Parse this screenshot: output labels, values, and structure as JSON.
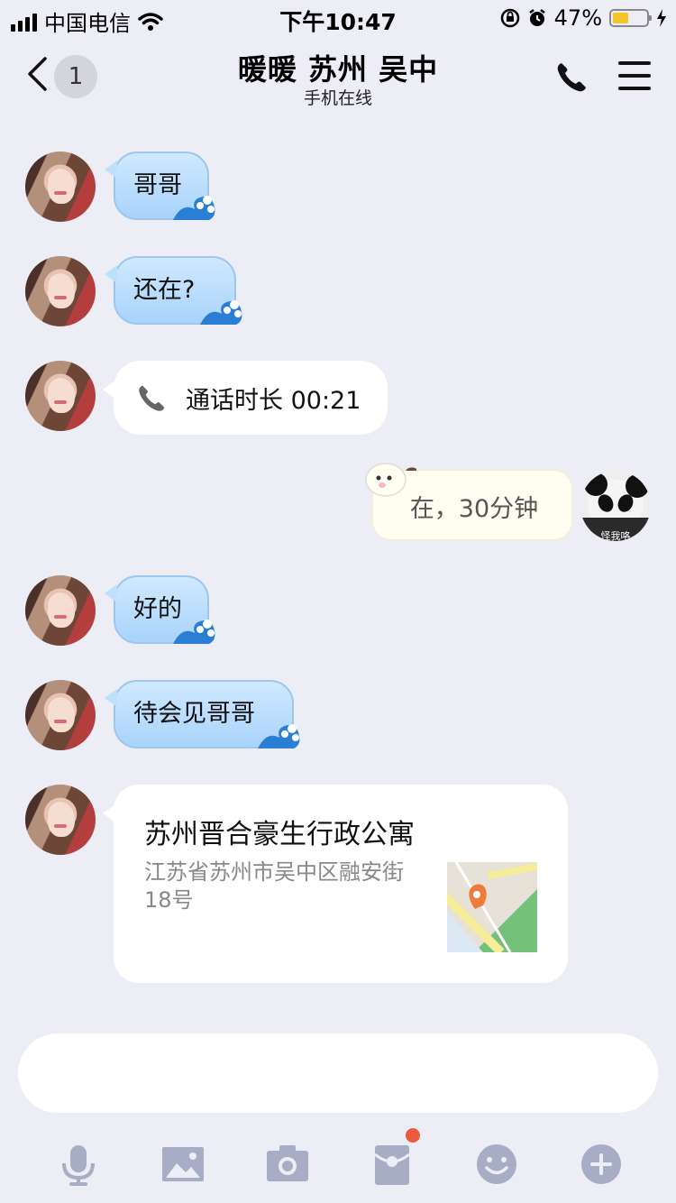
{
  "status_bar": {
    "carrier": "中国电信",
    "time": "下午10:47",
    "battery_percent": "47%",
    "battery_level": 0.47
  },
  "header": {
    "back_count": "1",
    "title": "暖暖 苏州 吴中",
    "subtitle": "手机在线"
  },
  "messages": [
    {
      "text": "哥哥"
    },
    {
      "text": "还在?"
    },
    {
      "call_label": "通话时长 00:21"
    },
    {
      "text": "在，30分钟",
      "avatar_caption": "怪我咯"
    },
    {
      "text": "好的"
    },
    {
      "text": "待会见哥哥"
    },
    {
      "location_title": "苏州晋合豪生行政公寓",
      "location_address": "江苏省苏州市吴中区融安街18号"
    }
  ],
  "toolbar": {
    "icons": [
      "microphone-icon",
      "image-icon",
      "camera-icon",
      "red-packet-icon",
      "emoji-icon",
      "plus-icon"
    ],
    "red_packet_badge": true
  },
  "colors": {
    "background": "#ecedf5",
    "blue_bubble": "#bde0fd",
    "badge_red": "#f05a3c",
    "battery": "#f5c428"
  }
}
